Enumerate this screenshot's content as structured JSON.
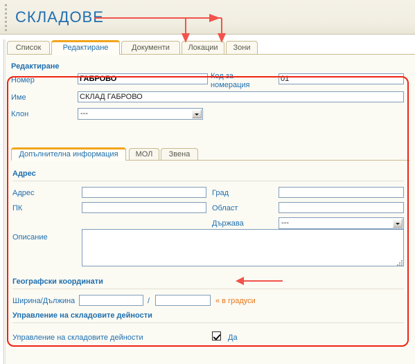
{
  "header": {
    "title": "СКЛАДОВЕ",
    "grip_icon": "drag-grip-icon"
  },
  "tabs": [
    {
      "label": "Список",
      "active": false
    },
    {
      "label": "Редактиране",
      "active": true
    },
    {
      "label": "Документи",
      "active": false
    },
    {
      "label": "Локации",
      "active": false
    },
    {
      "label": "Зони",
      "active": false
    }
  ],
  "panel": {
    "section_title": "Редактиране"
  },
  "main_fields": {
    "number_label": "Номер",
    "number_value": "ГАБРОВО",
    "code_label": "Код за\nномерация",
    "code_value": "01",
    "name_label": "Име",
    "name_value": "СКЛАД ГАБРОВО",
    "branch_label": "Клон",
    "branch_value": "---"
  },
  "inner_tabs": [
    {
      "label": "Допълнителна информация",
      "active": true
    },
    {
      "label": "МОЛ",
      "active": false
    },
    {
      "label": "Звена",
      "active": false
    }
  ],
  "address_section": {
    "heading": "Адрес",
    "address_label": "Адрес",
    "address_value": "",
    "postcode_label": "ПК",
    "postcode_value": "",
    "city_label": "Град",
    "city_value": "",
    "region_label": "Област",
    "region_value": "",
    "country_label": "Държава",
    "country_value": "---",
    "description_label": "Описание",
    "description_value": ""
  },
  "geo_section": {
    "heading": "Географски координати",
    "latlon_label": "Ширина/Дължина",
    "latitude_value": "",
    "longitude_value": "",
    "separator": "/",
    "hint": "« в градуси"
  },
  "warehouse_section": {
    "heading": "Управление на складовите дейности",
    "checkbox_label": "Управление на складовите дейности",
    "checkbox_state_label": "Да",
    "checked": true
  },
  "annotations": {
    "highlight_color": "#ee2211",
    "arrow_color": "#f2534a",
    "targets": [
      "Локации",
      "Зони",
      "Да"
    ]
  },
  "colors": {
    "accent_blue": "#1f6fb0",
    "tab_orange": "#f2a41a",
    "header_bg": "#f2efe4",
    "panel_bg": "#fbfaf3",
    "hint_orange": "#e8771a"
  }
}
